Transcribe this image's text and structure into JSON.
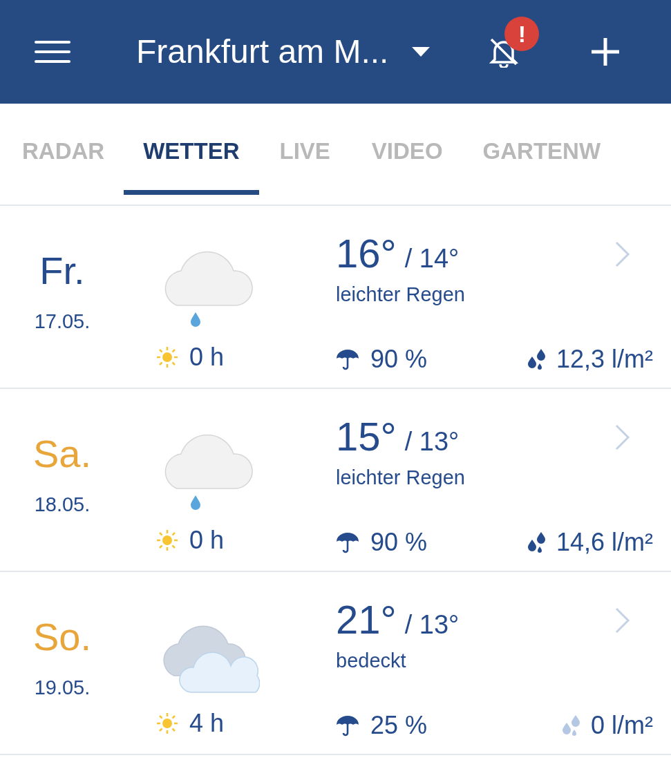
{
  "header": {
    "location": "Frankfurt am M...",
    "badge": "!"
  },
  "tabs": [
    {
      "label": "RADAR",
      "selected": false
    },
    {
      "label": "WETTER",
      "selected": true
    },
    {
      "label": "LIVE",
      "selected": false
    },
    {
      "label": "VIDEO",
      "selected": false
    },
    {
      "label": "GARTENW",
      "selected": false
    }
  ],
  "days": [
    {
      "day": "Fr.",
      "color": "#254b8c",
      "date": "17.05.",
      "kind": "rain",
      "high": "16°",
      "low": "/ 14°",
      "condition": "leichter Regen",
      "sun": "0 h",
      "probability": "90 %",
      "amount": "12,3 l/m²",
      "dry": false
    },
    {
      "day": "Sa.",
      "color": "#e8a53a",
      "date": "18.05.",
      "kind": "rain",
      "high": "15°",
      "low": "/ 13°",
      "condition": "leichter Regen",
      "sun": "0 h",
      "probability": "90 %",
      "amount": "14,6 l/m²",
      "dry": false
    },
    {
      "day": "So.",
      "color": "#e8a53a",
      "date": "19.05.",
      "kind": "overcast",
      "high": "21°",
      "low": "/ 13°",
      "condition": "bedeckt",
      "sun": "4 h",
      "probability": "25 %",
      "amount": "0 l/m²",
      "dry": true
    }
  ]
}
